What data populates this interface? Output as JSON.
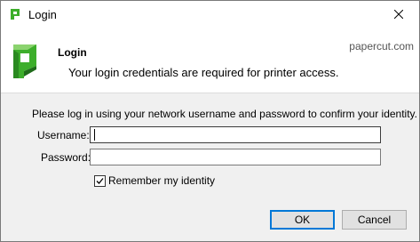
{
  "window": {
    "title": "Login",
    "close_icon": "close-icon"
  },
  "header": {
    "title": "Login",
    "subtitle": "Your login credentials are required for printer access.",
    "domain": "papercut.com",
    "logo_icon": "papercut-logo-icon",
    "brand_colors": {
      "green": "#3dae2b",
      "dark_green": "#1f6b1a",
      "light_green": "#8bd36f"
    }
  },
  "form": {
    "instructions": "Please log in using your network username and password to confirm your identity.",
    "username_label": "Username:",
    "username_value": "",
    "password_label": "Password:",
    "password_value": "",
    "remember_label": "Remember my identity",
    "remember_checked": true
  },
  "buttons": {
    "ok_label": "OK",
    "cancel_label": "Cancel"
  }
}
